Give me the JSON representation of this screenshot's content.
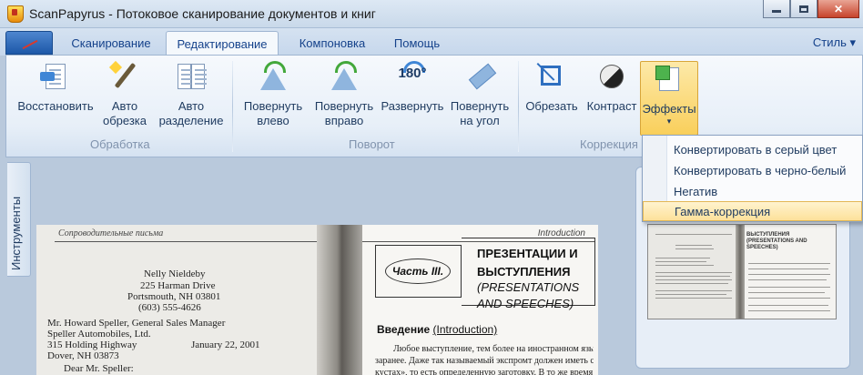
{
  "window": {
    "title": "ScanPapyrus - Потоковое сканирование документов и книг",
    "controls": {
      "minimize": "minimize-icon",
      "maximize": "maximize-icon",
      "close": "✕"
    }
  },
  "tabs": [
    {
      "label": "Сканирование",
      "active": false
    },
    {
      "label": "Редактирование",
      "active": true
    },
    {
      "label": "Компоновка",
      "active": false
    },
    {
      "label": "Помощь",
      "active": false
    }
  ],
  "style_menu": "Стиль ▾",
  "ribbon": {
    "groups": [
      {
        "label": "Обработка",
        "buttons": [
          {
            "l1": "Восстановить",
            "l2": ""
          },
          {
            "l1": "Авто",
            "l2": "обрезка"
          },
          {
            "l1": "Авто",
            "l2": "разделение"
          }
        ]
      },
      {
        "label": "Поворот",
        "buttons": [
          {
            "l1": "Повернуть",
            "l2": "влево"
          },
          {
            "l1": "Повернуть",
            "l2": "вправо"
          },
          {
            "l1": "Развернуть",
            "l2": "",
            "icon_text": "180°"
          },
          {
            "l1": "Повернуть",
            "l2": "на угол"
          }
        ]
      },
      {
        "label": "Коррекция",
        "buttons": [
          {
            "l1": "Обрезать",
            "l2": ""
          },
          {
            "l1": "Контраст",
            "l2": ""
          },
          {
            "l1": "Эффекты",
            "l2": "▾"
          }
        ]
      }
    ]
  },
  "effects_menu": {
    "items": [
      {
        "label": "Конвертировать в серый цвет"
      },
      {
        "label": "Конвертировать в черно-белый"
      },
      {
        "label": "Негатив"
      },
      {
        "label": "Гамма-коррекция",
        "highlighted": true
      }
    ]
  },
  "side_panel": {
    "tab_label": "Инструменты"
  },
  "document": {
    "left_page": {
      "header": "Сопроводительные письма",
      "lines": [
        "Nelly Nieldeby",
        "225 Harman Drive",
        "Portsmouth, NH 03801",
        "(603) 555-4626",
        "Mr. Howard Speller, General Sales Manager",
        "Speller Automobiles, Ltd.",
        "315 Holding Highway",
        "Dover, NH 03873",
        "January 22, 2001",
        "Dear Mr. Speller:"
      ]
    },
    "right_page": {
      "header": "Introduction",
      "part": "Часть III.",
      "chapter_title": "ПРЕЗЕНТАЦИИ И ВЫСТУПЛЕНИЯ",
      "chapter_subtitle": "(PRESENTATIONS AND SPEECHES)",
      "section_prefix": "Введение ",
      "section_link": "(Introduction)",
      "body": [
        "Любое выступление, тем более на иностранном языке, готовится",
        "заранее. Даже так называемый экспромт должен иметь свою бронь в",
        "кустах», то есть определенную заготовку. В то же время мы хотим от"
      ]
    }
  },
  "thumbnail": {
    "title": "ВЫСТУПЛЕНИЯ",
    "subtitle": "(PRESENTATIONS AND SPEECHES)"
  },
  "colors": {
    "ribbon": "#e7eff8",
    "workspace": "#b9c9dc",
    "highlight": "#fde19a",
    "accent": "#15428b"
  }
}
